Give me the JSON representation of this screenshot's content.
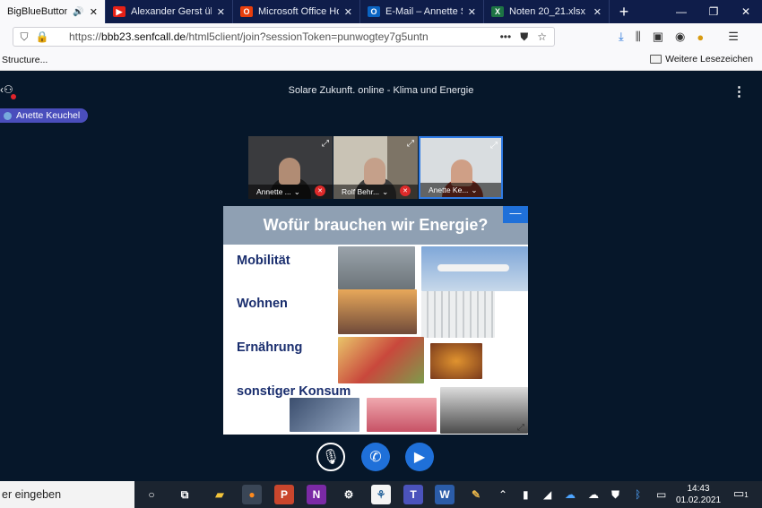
{
  "browser": {
    "tabs": [
      {
        "label": "BigBlueButton - Sc",
        "favicon": "bigbluebutton-icon",
        "color": "#0f1d4a",
        "active": true
      },
      {
        "label": "Alexander Gerst über",
        "favicon": "youtube-icon",
        "color": "#e62117"
      },
      {
        "label": "Microsoft Office Home",
        "favicon": "office-icon",
        "color": "#e83e0c"
      },
      {
        "label": "E-Mail – Annette Schu",
        "favicon": "outlook-icon",
        "color": "#0a64c2"
      },
      {
        "label": "Noten 20_21.xlsx",
        "favicon": "excel-icon",
        "color": "#1d7444"
      }
    ],
    "tab_close": "✕",
    "new_tab": "+",
    "url_host": "bbb23.senfcall.de",
    "url_prefix": "https://",
    "url_path": "/html5client/join?sessionToken=punwogtey7g5untn",
    "url_more": "•••",
    "bookmark_left": "Structure...",
    "bookmark_right": "Weitere Lesezeichen"
  },
  "meeting": {
    "title": "Solare Zukunft. online - Klima und Energie",
    "talker": "Anette Keuchel",
    "videos": [
      {
        "label": "Annette ...",
        "muted": true,
        "talking": false,
        "bg": "#3a3b3e"
      },
      {
        "label": "Rolf Behr...",
        "muted": true,
        "talking": false,
        "bg": "#7d7466"
      },
      {
        "label": "Anette Ke...",
        "muted": false,
        "talking": true,
        "bg": "#d9dde0"
      }
    ]
  },
  "slide": {
    "title": "Wofür brauchen wir Energie?",
    "items": [
      "Mobilität",
      "Wohnen",
      "Ernährung",
      "sonstiger Konsum"
    ],
    "minimize": "—"
  },
  "taskbar": {
    "search_placeholder": "er eingeben",
    "time": "14:43",
    "date": "01.02.2021",
    "notifications": "1"
  }
}
